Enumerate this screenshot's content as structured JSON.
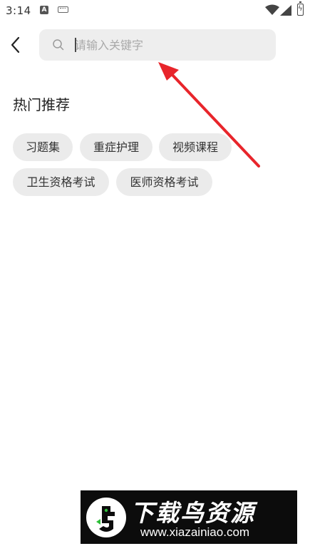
{
  "status_bar": {
    "time": "3:14",
    "notification_badge": "A"
  },
  "search": {
    "placeholder": "请输入关键字",
    "value": ""
  },
  "hot": {
    "title": "热门推荐",
    "tags": [
      "习题集",
      "重症护理",
      "视频课程",
      "卫生资格考试",
      "医师资格考试"
    ]
  },
  "annotation": {
    "color": "#e8252b"
  },
  "watermark": {
    "title": "下载鸟资源",
    "url": "www.xiazainiao.com"
  }
}
